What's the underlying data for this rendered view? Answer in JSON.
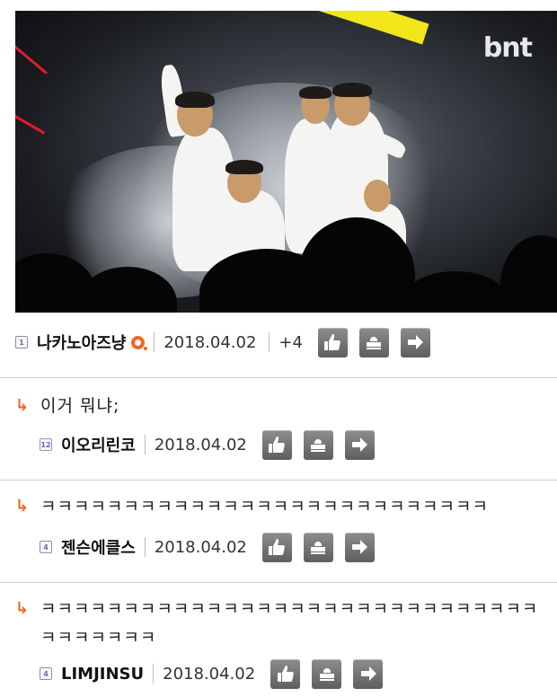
{
  "image": {
    "logo": "bnt"
  },
  "post": {
    "level": "1",
    "author": "나카노아즈냥",
    "date": "2018.04.02",
    "plus": "+4"
  },
  "comments": [
    {
      "text": "이거 뭐냐;",
      "level": "12",
      "author": "이오리린코",
      "date": "2018.04.02"
    },
    {
      "text": "ㅋㅋㅋㅋㅋㅋㅋㅋㅋㅋㅋㅋㅋㅋㅋㅋㅋㅋㅋㅋㅋㅋㅋㅋㅋㅋㅋ",
      "level": "4",
      "author": "젠슨에클스",
      "date": "2018.04.02"
    },
    {
      "text": "ㅋㅋㅋㅋㅋㅋㅋㅋㅋㅋㅋㅋㅋㅋㅋㅋㅋㅋㅋㅋㅋㅋㅋㅋㅋㅋㅋㅋㅋㅋㅋㅋㅋㅋㅋㅋㅋ",
      "level": "4",
      "author": "LIMJINSU",
      "date": "2018.04.02"
    }
  ],
  "icons": {
    "like": "thumbs-up-icon",
    "scrap": "stamp-icon",
    "share": "arrow-right-icon",
    "reply": "reply-arrow-icon",
    "badge": "orange-o-badge-icon"
  },
  "colors": {
    "accent": "#f26522",
    "button": "#6f6f6f"
  }
}
